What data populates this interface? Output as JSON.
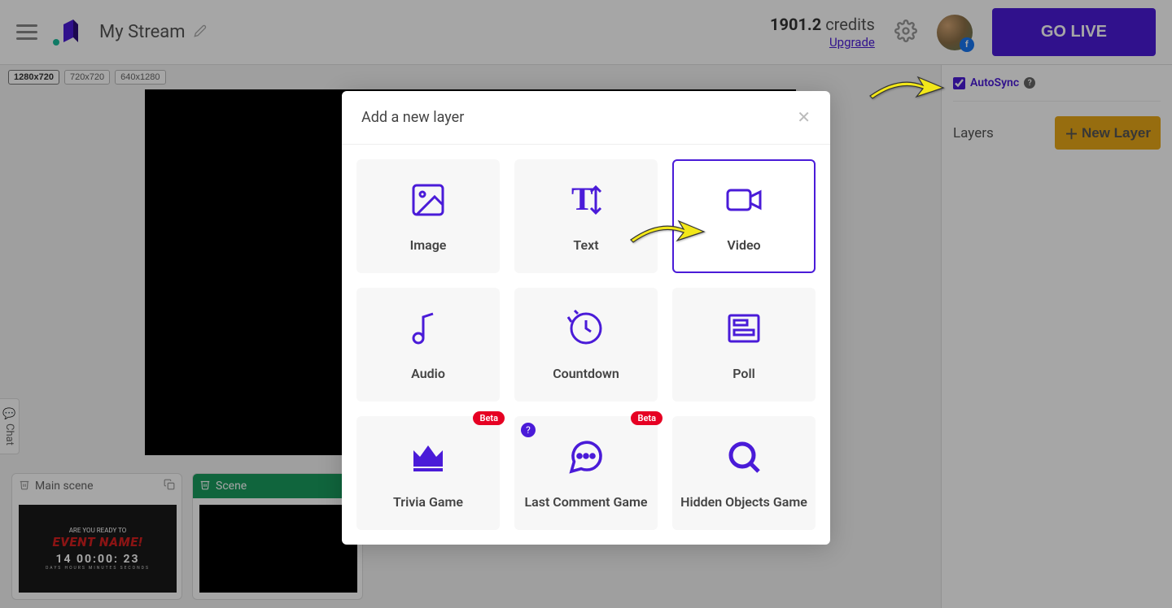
{
  "header": {
    "stream_title": "My Stream",
    "credits_number": "1901.2",
    "credits_word": "credits",
    "upgrade": "Upgrade",
    "go_live": "GO LIVE"
  },
  "resolutions": [
    "1280x720",
    "720x720",
    "640x1280"
  ],
  "chat_tab": "Chat",
  "scenes": {
    "main": {
      "title": "Main scene",
      "event_pre": "ARE YOU READY TO",
      "event_name": "EVENT NAME!",
      "timer": "14 00:00: 23",
      "labels": "DAYS   HOURS   MINUTES   SECONDS"
    },
    "scene2": {
      "title": "Scene"
    }
  },
  "sidebar": {
    "autosync": "AutoSync",
    "layers": "Layers",
    "new_layer": "New Layer"
  },
  "modal": {
    "title": "Add a new layer",
    "options": {
      "image": "Image",
      "text": "Text",
      "video": "Video",
      "audio": "Audio",
      "countdown": "Countdown",
      "poll": "Poll",
      "trivia": "Trivia Game",
      "lastcomment": "Last Comment Game",
      "hidden": "Hidden Objects Game"
    },
    "beta": "Beta"
  }
}
